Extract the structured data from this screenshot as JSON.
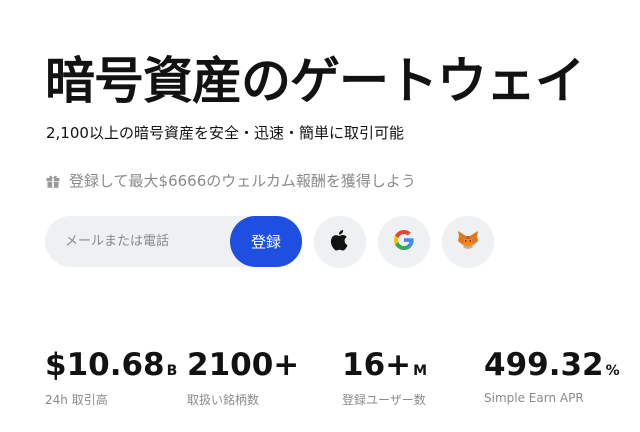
{
  "hero": {
    "title": "暗号資産のゲートウェイ",
    "subtitle": "2,100以上の暗号資産を安全・迅速・簡単に取引可能",
    "promo": "登録して最大$6666のウェルカム報酬を獲得しよう"
  },
  "signup": {
    "placeholder": "メールまたは電話",
    "register_label": "登録"
  },
  "social": [
    "apple-icon",
    "google-icon",
    "metamask-icon"
  ],
  "stats": [
    {
      "value": "$10.68",
      "unit": "B",
      "label": "24h 取引高"
    },
    {
      "value": "2100+",
      "unit": "",
      "label": "取扱い銘柄数"
    },
    {
      "value": "16+",
      "unit": "M",
      "label": "登録ユーザー数"
    },
    {
      "value": "499.32",
      "unit": "%",
      "label": "Simple Earn APR"
    }
  ],
  "colors": {
    "accent": "#1f4fe0",
    "text": "#121212",
    "muted": "#8a8a8a",
    "field_bg": "#eef0f2"
  }
}
